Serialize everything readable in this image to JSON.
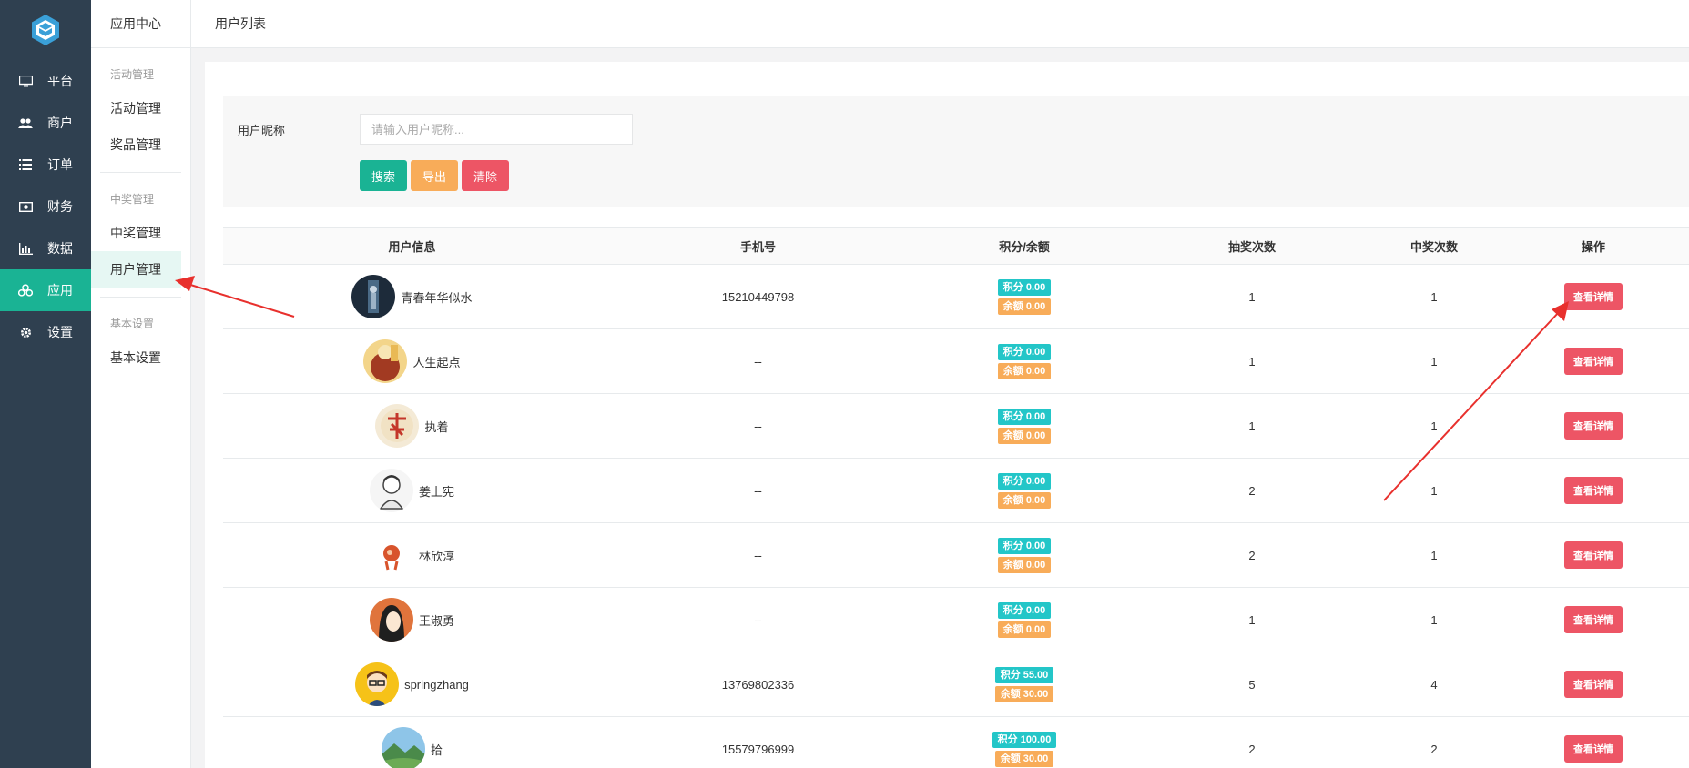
{
  "nav": {
    "items": [
      {
        "label": "平台",
        "icon": "monitor-icon"
      },
      {
        "label": "商户",
        "icon": "users-icon"
      },
      {
        "label": "订单",
        "icon": "list-icon"
      },
      {
        "label": "财务",
        "icon": "money-icon"
      },
      {
        "label": "数据",
        "icon": "bar-chart-icon"
      },
      {
        "label": "应用",
        "icon": "cubes-icon",
        "active": true
      },
      {
        "label": "设置",
        "icon": "gear-icon"
      }
    ]
  },
  "submenu": {
    "title": "应用中心",
    "groups": [
      {
        "label": "活动管理",
        "items": [
          "活动管理",
          "奖品管理"
        ]
      },
      {
        "label": "中奖管理",
        "items": [
          "中奖管理",
          "用户管理"
        ]
      },
      {
        "label": "基本设置",
        "items": [
          "基本设置"
        ]
      }
    ],
    "active_item": "用户管理"
  },
  "topbar": {
    "breadcrumb": "用户列表"
  },
  "search": {
    "label": "用户昵称",
    "placeholder": "请输入用户昵称...",
    "search_label": "搜索",
    "export_label": "导出",
    "clear_label": "清除"
  },
  "table": {
    "headers": [
      "用户信息",
      "手机号",
      "积分/余额",
      "抽奖次数",
      "中奖次数",
      "操作"
    ],
    "rows": [
      {
        "name": "青春年华似水",
        "phone": "15210449798",
        "score": "积分 0.00",
        "balance": "余额 0.00",
        "draws": "1",
        "wins": "1",
        "action": "查看详情"
      },
      {
        "name": "人生起点",
        "phone": "--",
        "score": "积分 0.00",
        "balance": "余额 0.00",
        "draws": "1",
        "wins": "1",
        "action": "查看详情"
      },
      {
        "name": "执着",
        "phone": "--",
        "score": "积分 0.00",
        "balance": "余额 0.00",
        "draws": "1",
        "wins": "1",
        "action": "查看详情"
      },
      {
        "name": "姜上宪",
        "phone": "--",
        "score": "积分 0.00",
        "balance": "余额 0.00",
        "draws": "2",
        "wins": "1",
        "action": "查看详情"
      },
      {
        "name": "林欣淳",
        "phone": "--",
        "score": "积分 0.00",
        "balance": "余额 0.00",
        "draws": "2",
        "wins": "1",
        "action": "查看详情"
      },
      {
        "name": "王淑勇",
        "phone": "--",
        "score": "积分 0.00",
        "balance": "余额 0.00",
        "draws": "1",
        "wins": "1",
        "action": "查看详情"
      },
      {
        "name": "springzhang",
        "phone": "13769802336",
        "score": "积分 55.00",
        "balance": "余额 30.00",
        "draws": "5",
        "wins": "4",
        "action": "查看详情"
      },
      {
        "name": "拾",
        "phone": "15579796999",
        "score": "积分 100.00",
        "balance": "余额 30.00",
        "draws": "2",
        "wins": "2",
        "action": "查看详情"
      }
    ]
  },
  "colors": {
    "nav_bg": "#2f4050",
    "accent": "#1ab394",
    "warning": "#f8ac59",
    "danger": "#ed5565",
    "info": "#23c6c8",
    "annotation": "#e8302d"
  }
}
